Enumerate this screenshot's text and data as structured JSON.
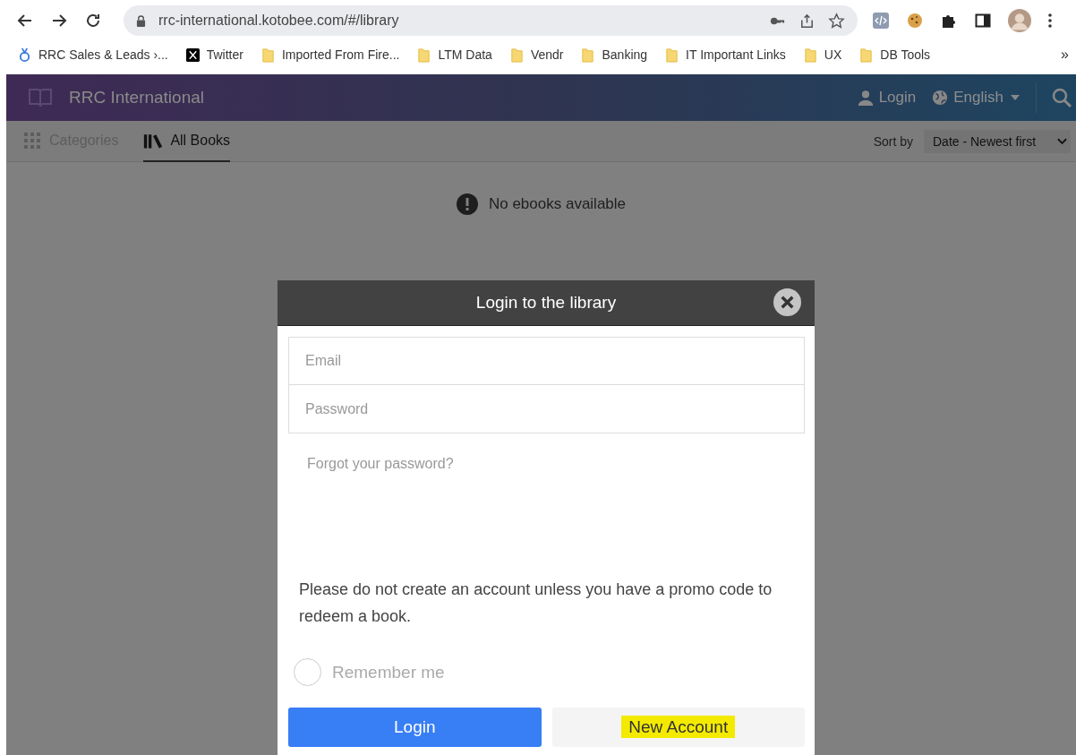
{
  "browser": {
    "url": "rrc-international.kotobee.com/#/library",
    "bookmarks": [
      {
        "label": "RRC Sales & Leads ›...",
        "kind": "app"
      },
      {
        "label": "Twitter",
        "kind": "x"
      },
      {
        "label": "Imported From Fire...",
        "kind": "folder"
      },
      {
        "label": "LTM Data",
        "kind": "folder"
      },
      {
        "label": "Vendr",
        "kind": "folder"
      },
      {
        "label": "Banking",
        "kind": "folder"
      },
      {
        "label": "IT Important Links",
        "kind": "folder"
      },
      {
        "label": "UX",
        "kind": "folder"
      },
      {
        "label": "DB Tools",
        "kind": "folder"
      }
    ],
    "more": "»"
  },
  "header": {
    "title": "RRC International",
    "login": "Login",
    "language": "English"
  },
  "tabs": [
    {
      "label": "Categories",
      "selected": false,
      "kind": "grid"
    },
    {
      "label": "All Books",
      "selected": true,
      "kind": "books"
    }
  ],
  "sort": {
    "label": "Sort by",
    "value": "Date - Newest first"
  },
  "empty_message": "No ebooks available",
  "modal": {
    "title": "Login to the library",
    "email_placeholder": "Email",
    "password_placeholder": "Password",
    "forgot": "Forgot your password?",
    "notice": "Please do not create an account unless you have a promo code to redeem a book.",
    "remember": {
      "label": "Remember me",
      "checked": false
    },
    "buttons": [
      {
        "label": "Login",
        "kind": "primary",
        "highlighted": false
      },
      {
        "label": "New Account",
        "kind": "secondary",
        "highlighted": true
      }
    ]
  }
}
